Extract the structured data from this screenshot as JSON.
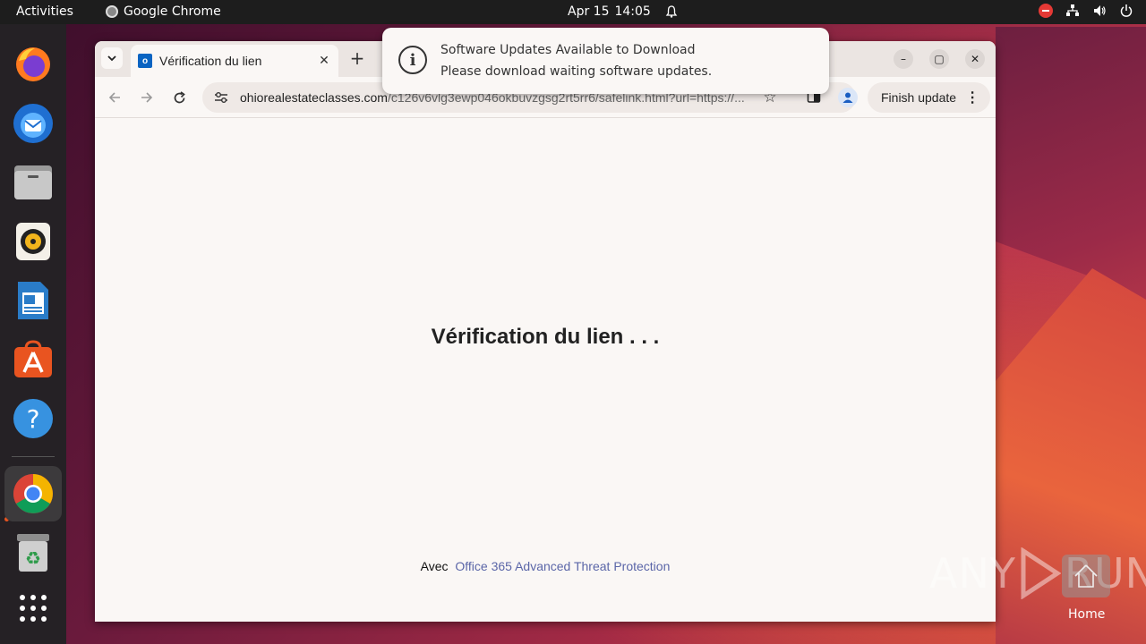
{
  "topbar": {
    "activities": "Activities",
    "app_name": "Google Chrome",
    "date": "Apr 15",
    "time": "14:05"
  },
  "dock": {
    "items": [
      "firefox",
      "thunderbird",
      "files",
      "rhythmbox",
      "libreoffice-writer",
      "app-center",
      "help",
      "google-chrome",
      "trash",
      "show-apps"
    ],
    "active": "google-chrome"
  },
  "browser": {
    "tab_title": "Vérification du lien",
    "url_host": "ohiorealestateclasses.com",
    "url_path": "/c126v6vlg3ewp046okbuvzgsg2rt5rr6/safelink.html?url=https://...",
    "finish_update_label": "Finish update"
  },
  "page": {
    "heading": "Vérification du lien  . . .",
    "footer_prefix": "Avec",
    "footer_link": "Office 365 Advanced Threat Protection"
  },
  "notification": {
    "title": "Software Updates Available to Download",
    "body": "Please download waiting software updates."
  },
  "watermark": {
    "left": "ANY",
    "right": "RUN"
  },
  "desktop": {
    "home_label": "Home"
  },
  "colors": {
    "accent": "#e95420",
    "link": "#5b66a8",
    "topbar": "#1d1d1d",
    "dock": "#252125"
  }
}
